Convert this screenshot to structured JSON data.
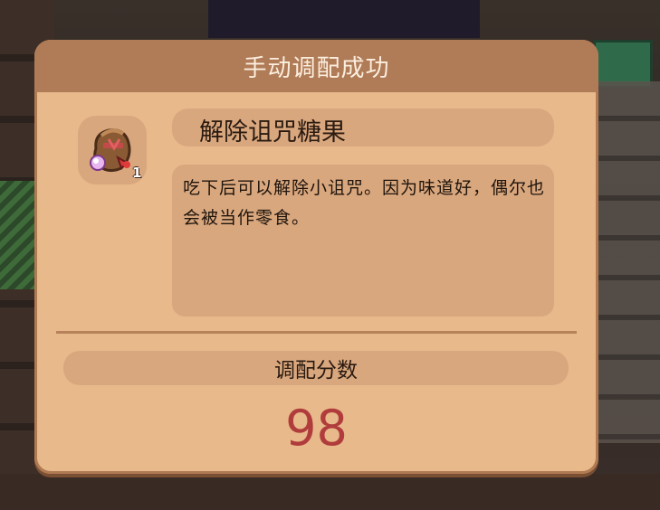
{
  "dialog": {
    "title": "手动调配成功",
    "item": {
      "icon": "curse-removal-candy-pouch-icon",
      "count": "1",
      "name": "解除诅咒糖果",
      "description": "吃下后可以解除小诅咒。因为味道好，偶尔也会被当作零食。"
    },
    "score": {
      "label": "调配分数",
      "value": "98"
    }
  },
  "colors": {
    "panel": "#e8b98b",
    "title_bar": "#b07b57",
    "inset": "#d9a77e",
    "score": "#b03c3c"
  }
}
